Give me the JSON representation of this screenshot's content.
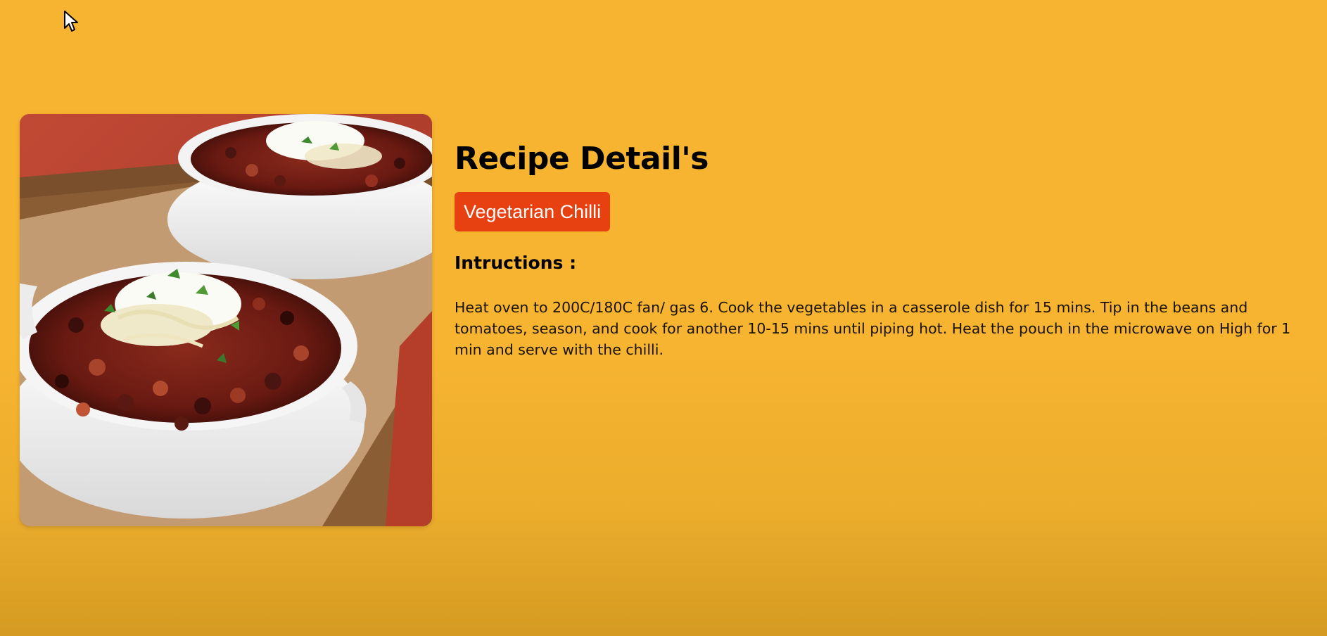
{
  "recipe": {
    "title": "Recipe Detail's",
    "category_label": "Vegetarian Chilli",
    "instructions_heading": "Intructions :",
    "instructions_text": "Heat oven to 200C/180C fan/ gas 6. Cook the vegetables in a casserole dish for 15 mins. Tip in the beans and tomatoes, season, and cook for another 10-15 mins until piping hot. Heat the pouch in the microwave on High for 1 min and serve with the chilli."
  },
  "icons": {
    "cursor": "mouse-pointer-icon"
  },
  "colors": {
    "background": "#f7b431",
    "badge": "#e74011",
    "badge_text": "#ffffff",
    "title_text": "#000000"
  }
}
